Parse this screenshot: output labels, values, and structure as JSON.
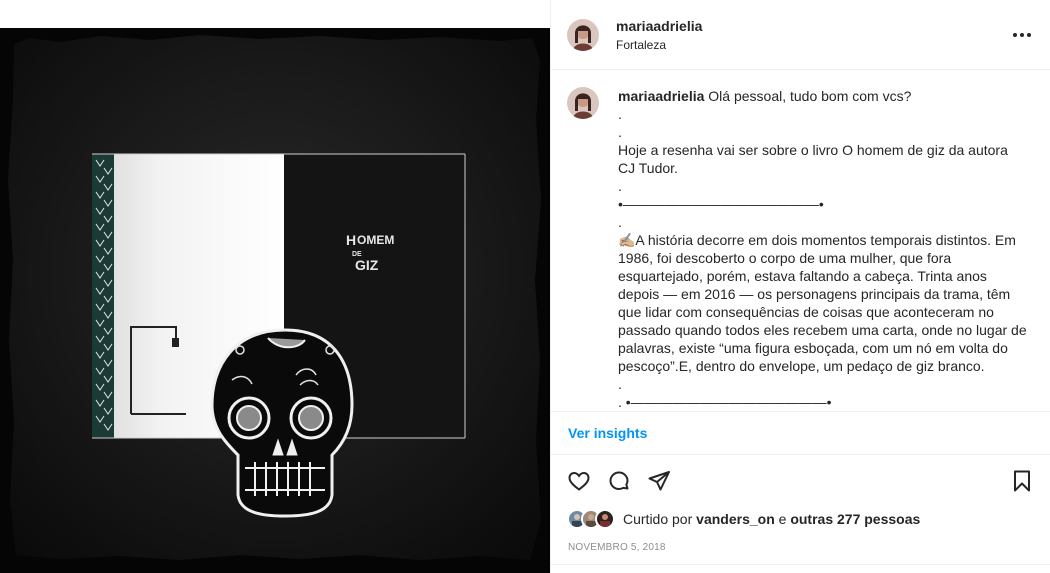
{
  "post": {
    "username": "mariaadrielia",
    "location": "Fortaleza",
    "book_title_art": [
      "H",
      "OMEM",
      "DE",
      "GIZ"
    ]
  },
  "caption": {
    "username": "mariaadrielia",
    "lines": [
      "Olá pessoal, tudo bom com vcs?",
      ".",
      ".",
      "Hoje a resenha vai ser sobre o livro O homem de giz da autora CJ Tudor.",
      ".",
      "•——————————————•",
      ".",
      "✍🏼A história decorre em dois momentos temporais distintos. Em 1986, foi descoberto o corpo de uma mulher, que fora esquartejado, porém, estava faltando a cabeça. Trinta anos depois — em 2016 — os personagens principais da trama, têm que lidar com consequências de coisas que aconteceram no passado quando todos eles recebem uma carta, onde no lugar de palavras, existe “uma figura esboçada, com um nó em volta do pescoço”.E, dentro do envelope, um pedaço de giz branco.",
      ".",
      ". •——————————————•"
    ]
  },
  "insights": {
    "label": "Ver insights"
  },
  "actions": {
    "like_icon": "heart-icon",
    "comment_icon": "comment-icon",
    "share_icon": "share-icon",
    "save_icon": "bookmark-icon"
  },
  "likes": {
    "prefix": "Curtido por",
    "user": "vanders_on",
    "joiner": "e",
    "others": "outras 277 pessoas"
  },
  "date": "NOVEMBRO 5, 2018",
  "colors": {
    "link": "#0095f6",
    "text": "#262626",
    "muted": "#8e8e8e",
    "border": "#efefef"
  }
}
